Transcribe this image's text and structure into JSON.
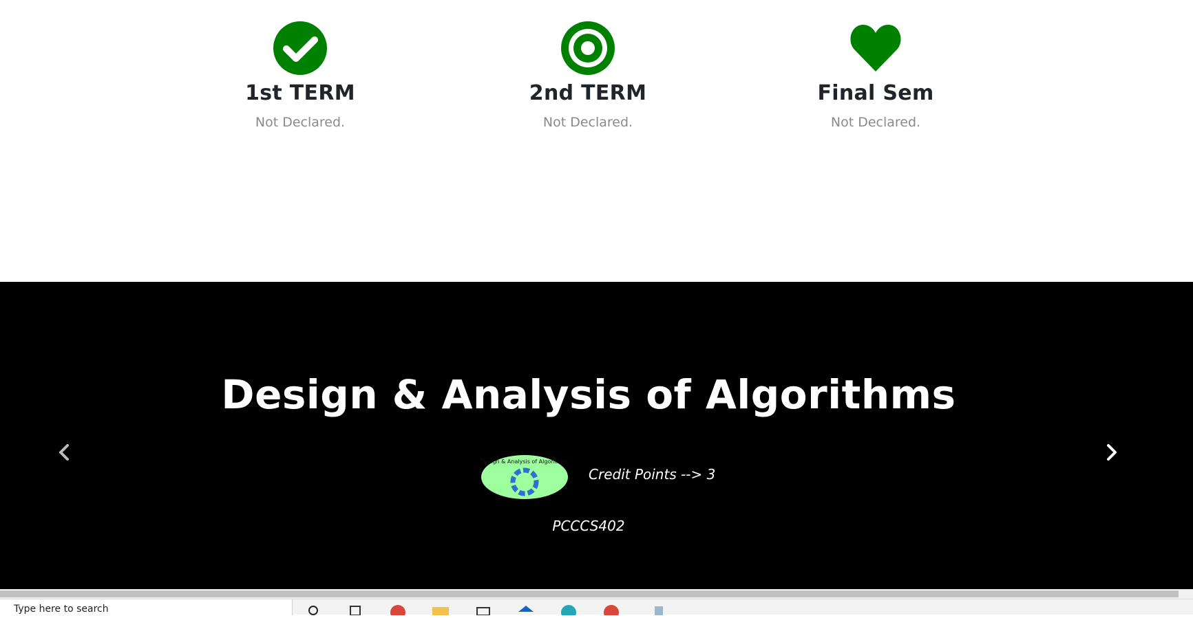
{
  "terms": [
    {
      "icon": "check-circle-icon",
      "title": "1st TERM",
      "status": "Not Declared."
    },
    {
      "icon": "target-icon",
      "title": "2nd TERM",
      "status": "Not Declared."
    },
    {
      "icon": "heart-icon",
      "title": "Final Sem",
      "status": "Not Declared."
    }
  ],
  "carousel": {
    "title": "Design & Analysis of Algorithms",
    "credit": "Credit Points --> 3",
    "code": "PCCCS402",
    "thumbnail_caption": "Design & Analysis of Algorithms",
    "prev_icon": "chevron-left-icon",
    "next_icon": "chevron-right-icon"
  },
  "colors": {
    "accent": "#008000",
    "dark": "#212529",
    "muted": "#8a8a8a",
    "carousel_bg": "#000000"
  },
  "taskbar": {
    "search_placeholder": "Type here to search"
  }
}
